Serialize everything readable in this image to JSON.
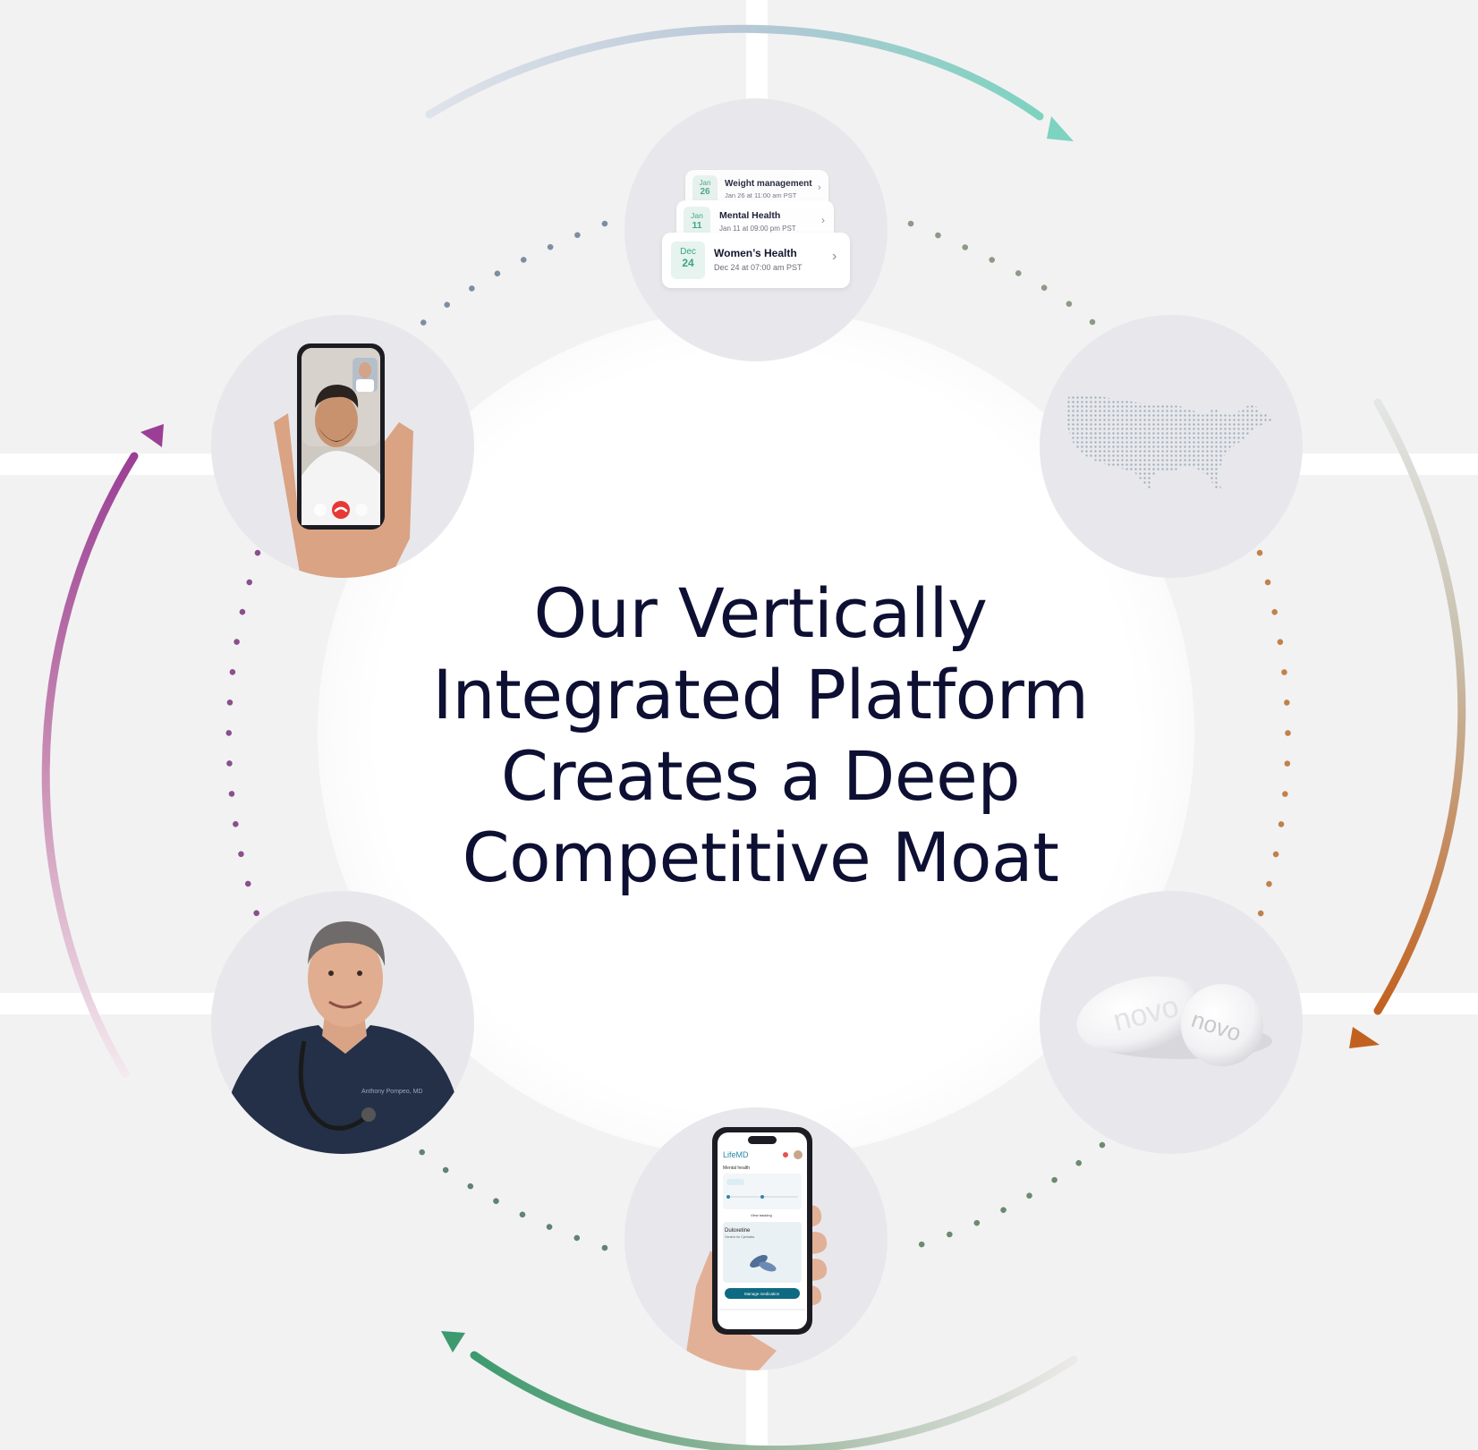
{
  "headline": {
    "line1": "Our Vertically",
    "line2": "Integrated Platform",
    "line3": "Creates a Deep",
    "line4": "Competitive Moat"
  },
  "appointments": [
    {
      "month": "Jan",
      "day": "26",
      "title": "Weight management",
      "detail": "Jan 26 at 11:00 am PST"
    },
    {
      "month": "Jan",
      "day": "11",
      "title": "Mental Health",
      "detail": "Jan 11 at 09:00 pm PST"
    },
    {
      "month": "Dec",
      "day": "24",
      "title": "Women’s Health",
      "detail": "Dec 24 at 07:00 am PST"
    }
  ],
  "pill": {
    "imprint_left": "novo",
    "imprint_right": "novo"
  },
  "doctor": {
    "coat_name": "Anthony Pompeo, MD"
  },
  "app_screen": {
    "brand": "LifeMD",
    "section": "Mental health",
    "medication": "Duloxetine",
    "medication_note": "Generic for Cymbalta",
    "track_button": "View tracking",
    "manage_button": "Manage medication"
  },
  "nodes": [
    "appointments-node",
    "us-map-node",
    "pill-node",
    "mobile-app-node",
    "doctor-node",
    "video-call-node"
  ],
  "colors": {
    "title": "#0d0f33",
    "node_bg": "#e8e8ec",
    "arc_top": "#7dd3bf",
    "arc_right": "#c2611f",
    "arc_bottom": "#3d9a6e",
    "arc_left": "#9a3f95",
    "accent_green": "#3aa57e",
    "call_red": "#e53935"
  },
  "icons": [
    "arrowhead-icon",
    "chevron-right-icon",
    "end-call-icon"
  ]
}
